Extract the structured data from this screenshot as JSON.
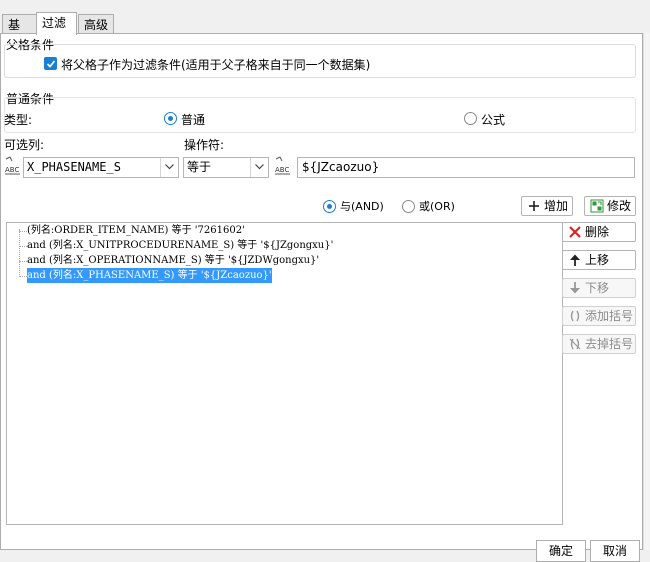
{
  "tabs": [
    {
      "label": "基本"
    },
    {
      "label": "过滤"
    },
    {
      "label": "高级"
    }
  ],
  "parent": {
    "title": "父格条件",
    "checkbox_label": "将父格子作为过滤条件(适用于父子格来自于同一个数据集)",
    "checked": true
  },
  "normal": {
    "title": "普通条件",
    "type_label": "类型:",
    "type_option_normal": "普通",
    "type_option_formula": "公式",
    "selected_type": "普通",
    "available_label": "可选列:",
    "operator_label": "操作符:",
    "column_value": "X_PHASENAME_S",
    "operator_value": "等于",
    "value_text": "${JZcaozuo}",
    "logic_and": "与(AND)",
    "logic_or": "或(OR)",
    "selected_logic": "and",
    "add_label": "增加",
    "modify_label": "修改"
  },
  "conditions": [
    "(列名:ORDER_ITEM_NAME) 等于 '7261602'",
    "and (列名:X_UNITPROCEDURENAME_S) 等于 '${JZgongxu}'",
    "and (列名:X_OPERATIONNAME_S) 等于 '${JZDWgongxu}'",
    "and (列名:X_PHASENAME_S) 等于 '${JZcaozuo}'"
  ],
  "side_buttons": {
    "delete": "删除",
    "up": "上移",
    "down": "下移",
    "add_bracket": "添加括号",
    "remove_bracket": "去掉括号"
  },
  "footer": {
    "ok": "确定",
    "cancel": "取消"
  },
  "colors": {
    "accent": "#1a7fd4",
    "selection": "#3399ff",
    "delete_red": "#e02020",
    "modify_green": "#2e9a3a"
  }
}
